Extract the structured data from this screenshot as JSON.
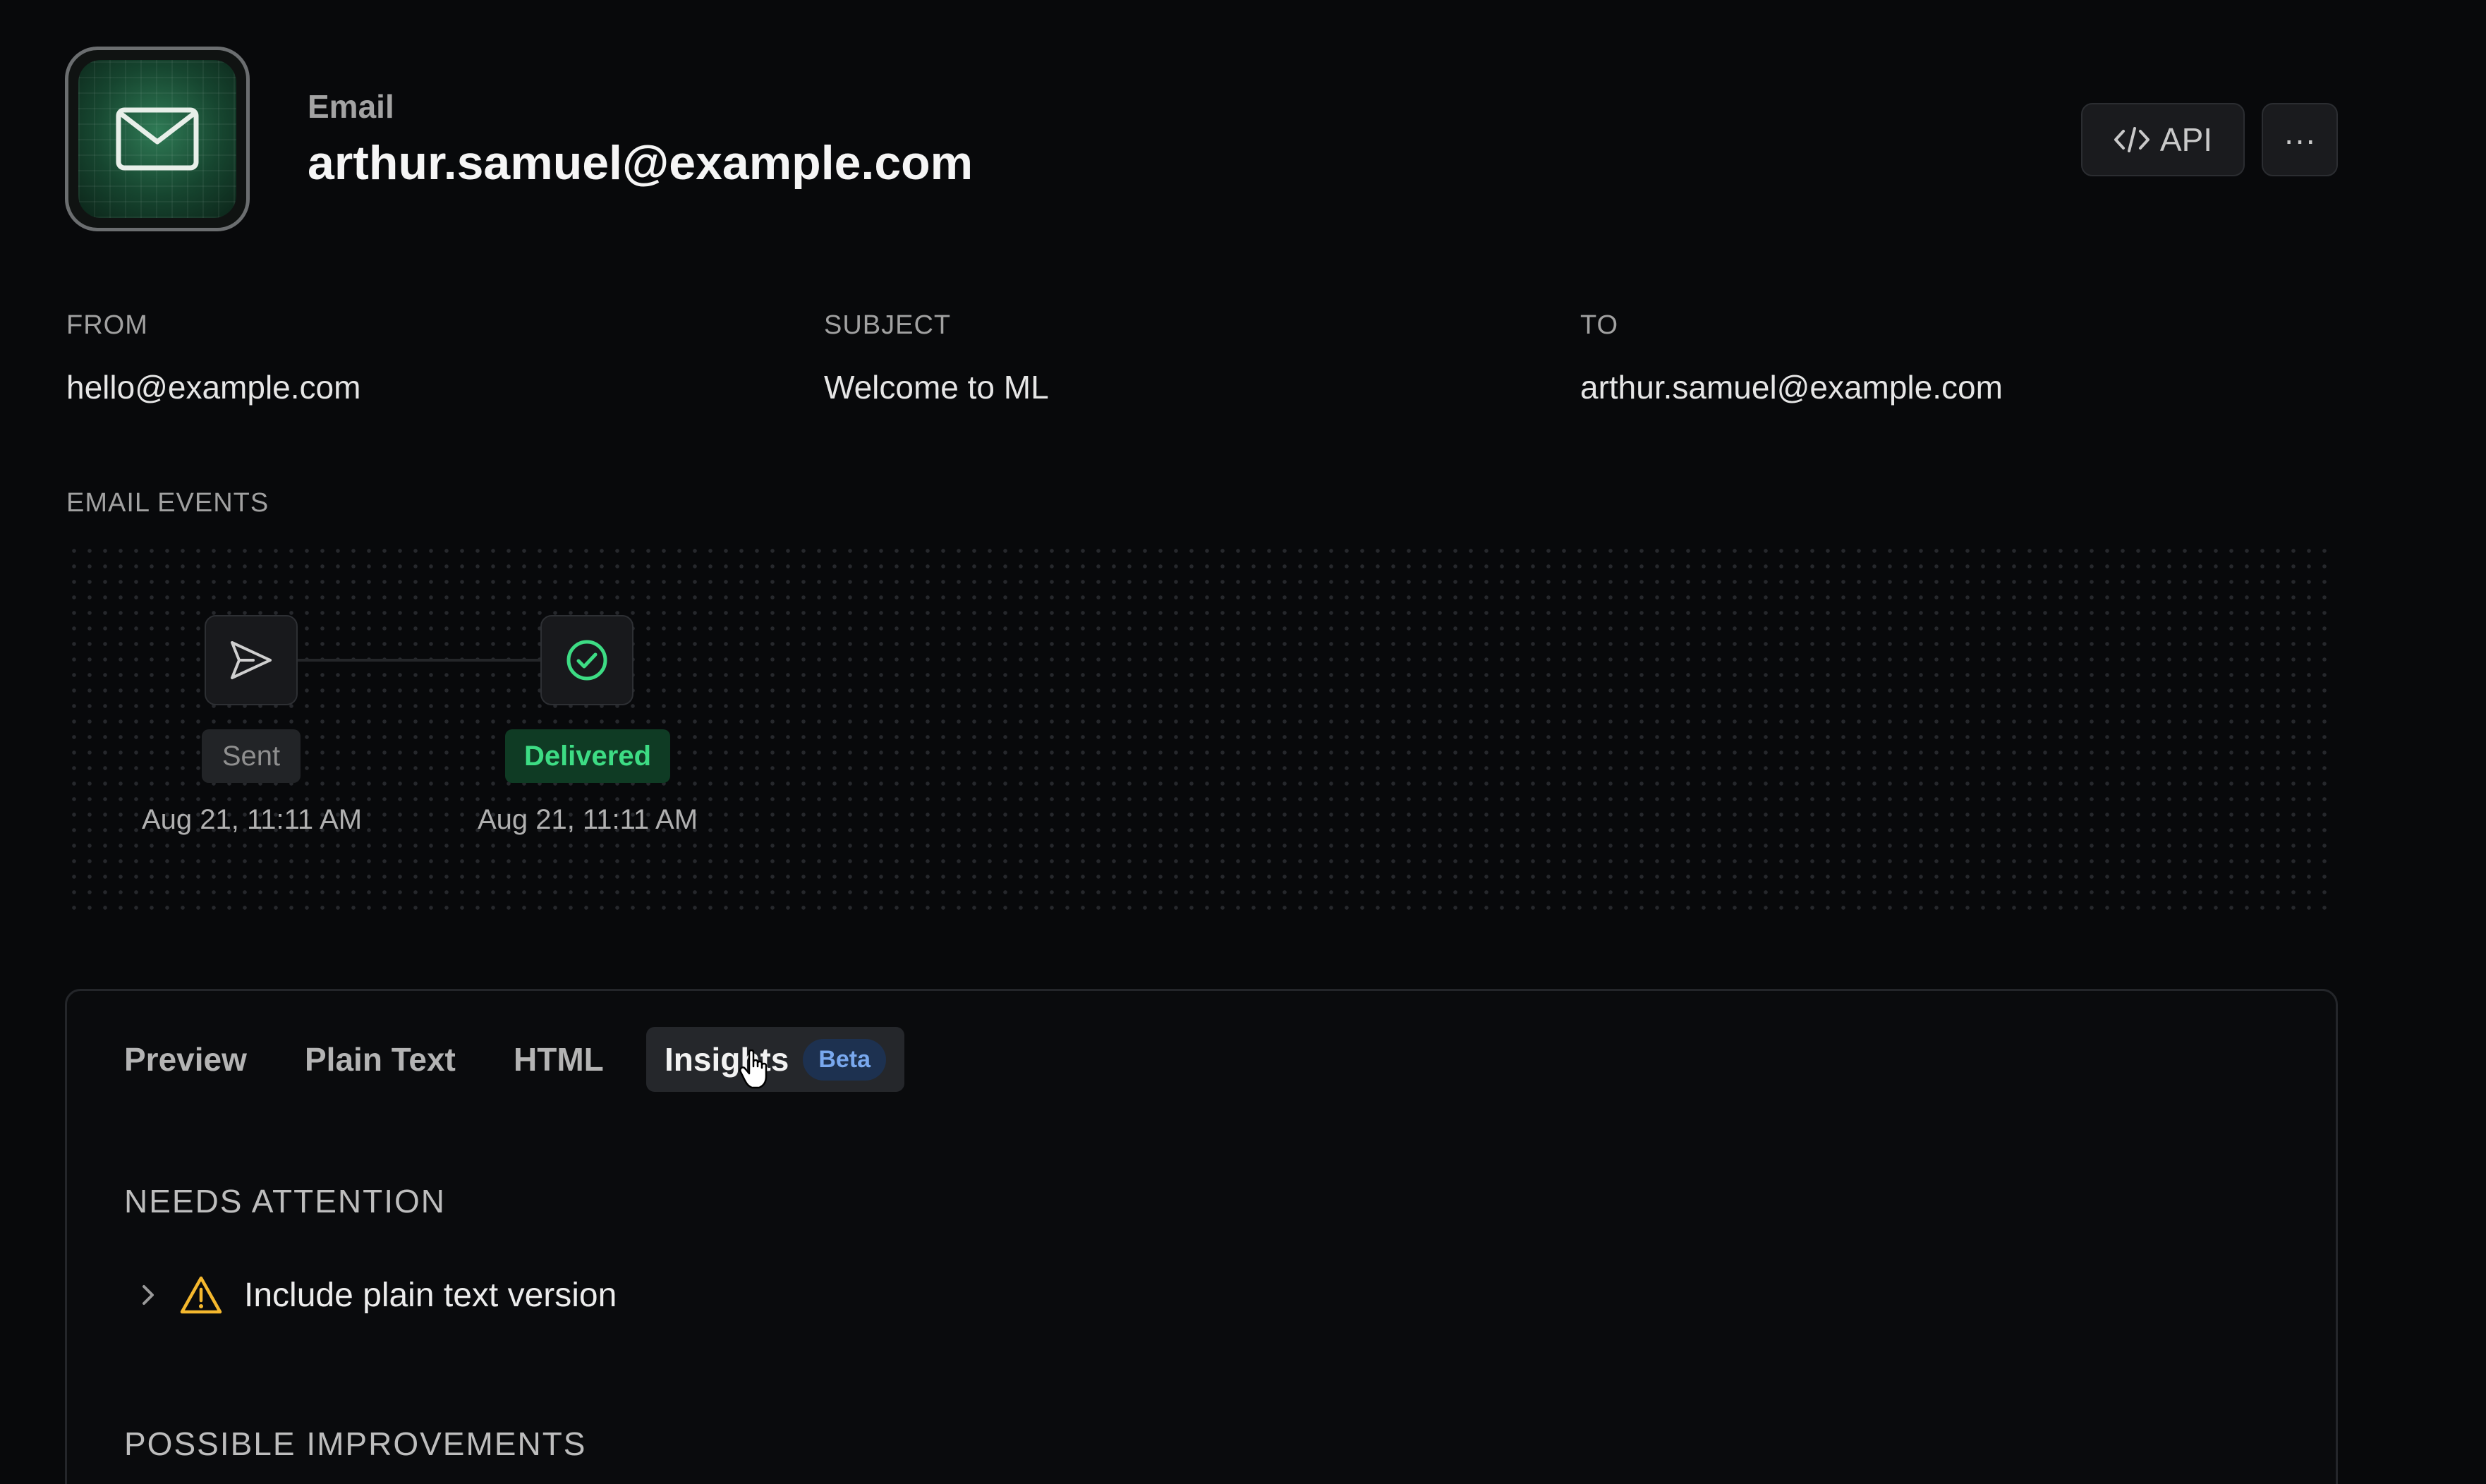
{
  "header": {
    "label": "Email",
    "title": "arthur.samuel@example.com",
    "api_label": "API",
    "more_label": "···"
  },
  "meta": {
    "from_label": "FROM",
    "from_value": "hello@example.com",
    "subject_label": "SUBJECT",
    "subject_value": "Welcome to ML",
    "to_label": "TO",
    "to_value": "arthur.samuel@example.com"
  },
  "events": {
    "section_label": "EMAIL EVENTS",
    "items": [
      {
        "status": "Sent",
        "time": "Aug 21, 11:11 AM",
        "icon": "send-icon"
      },
      {
        "status": "Delivered",
        "time": "Aug 21, 11:11 AM",
        "icon": "check-circle-icon"
      }
    ]
  },
  "tabs": [
    {
      "label": "Preview"
    },
    {
      "label": "Plain Text"
    },
    {
      "label": "HTML"
    },
    {
      "label": "Insights",
      "badge": "Beta",
      "active": true
    }
  ],
  "insights": {
    "needs_attention_label": "NEEDS ATTENTION",
    "needs_attention_items": [
      {
        "text": "Include plain text version",
        "icon": "warning-icon"
      }
    ],
    "possible_improvements_label": "POSSIBLE IMPROVEMENTS"
  },
  "colors": {
    "background": "#08090b",
    "delivered_green": "#3ddc84",
    "warning_yellow": "#f5b82e",
    "beta_blue": "#79a8ee"
  }
}
